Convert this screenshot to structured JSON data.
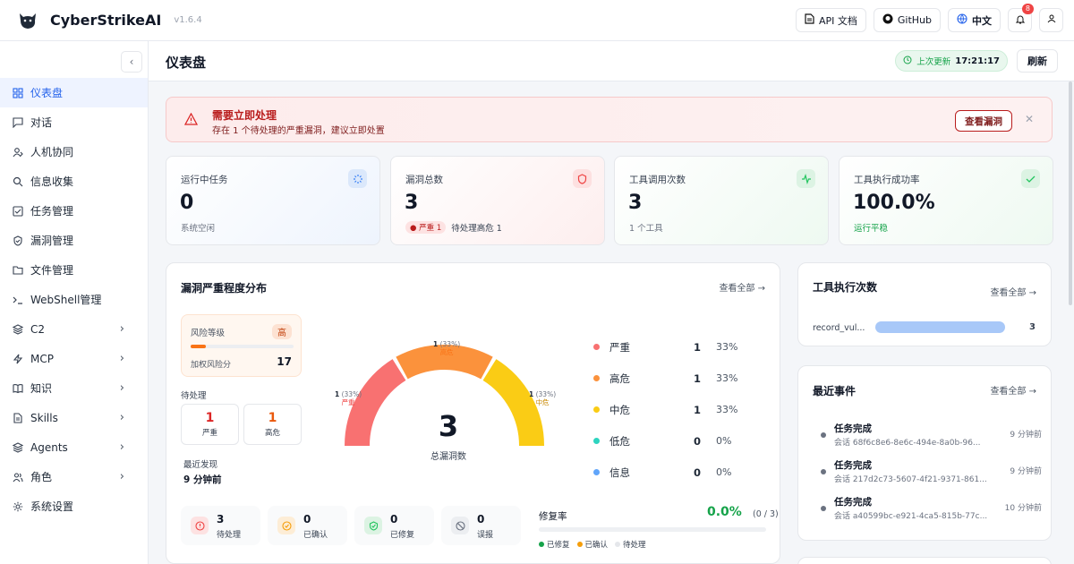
{
  "app": {
    "name": "CyberStrikeAI",
    "version": "v1.6.4"
  },
  "topbar": {
    "api_docs": "API 文档",
    "github": "GitHub",
    "language": "中文",
    "notification_count": "8"
  },
  "sidebar": {
    "items": [
      {
        "label": "仪表盘",
        "icon": "dashboard-icon"
      },
      {
        "label": "对话",
        "icon": "chat-icon"
      },
      {
        "label": "人机协同",
        "icon": "user-collab-icon"
      },
      {
        "label": "信息收集",
        "icon": "search-icon"
      },
      {
        "label": "任务管理",
        "icon": "task-icon"
      },
      {
        "label": "漏洞管理",
        "icon": "shield-icon"
      },
      {
        "label": "文件管理",
        "icon": "folder-icon"
      },
      {
        "label": "WebShell管理",
        "icon": "terminal-icon"
      },
      {
        "label": "C2",
        "icon": "layers-icon"
      },
      {
        "label": "MCP",
        "icon": "bolt-icon"
      },
      {
        "label": "知识",
        "icon": "book-icon"
      },
      {
        "label": "Skills",
        "icon": "document-icon"
      },
      {
        "label": "Agents",
        "icon": "layers-icon"
      },
      {
        "label": "角色",
        "icon": "users-icon"
      },
      {
        "label": "系统设置",
        "icon": "gear-icon"
      }
    ]
  },
  "header": {
    "title": "仪表盘",
    "last_update_label": "上次更新",
    "last_update_time": "17:21:17",
    "refresh": "刷新"
  },
  "alert": {
    "title": "需要立即处理",
    "desc": "存在 1 个待处理的严重漏洞，建议立即处置",
    "button": "查看漏洞"
  },
  "stats": [
    {
      "label": "运行中任务",
      "value": "0",
      "sub": "系统空闲"
    },
    {
      "label": "漏洞总数",
      "value": "3",
      "pill": "● 严重 1",
      "sub": "待处理高危 1"
    },
    {
      "label": "工具调用次数",
      "value": "3",
      "sub": "1 个工具"
    },
    {
      "label": "工具执行成功率",
      "value": "100.0%",
      "sub": "运行平稳"
    }
  ],
  "vuln_card": {
    "title": "漏洞严重程度分布",
    "view_all": "查看全部 →",
    "risk_label": "风险等级",
    "risk_level": "高",
    "risk_progress": 0.15,
    "risk_score_label": "加权风险分",
    "risk_score": "17",
    "pending_label": "待处理",
    "pending": [
      {
        "num": "1",
        "label": "严重"
      },
      {
        "num": "1",
        "label": "高危"
      }
    ],
    "recent_label": "最近发现",
    "recent_value": "9 分钟前",
    "total": "3",
    "total_label": "总漏洞数",
    "gauge_labels": [
      {
        "count": "1",
        "pct": "(33%)",
        "name": "严重"
      },
      {
        "count": "1",
        "pct": "(33%)",
        "name": "高危"
      },
      {
        "count": "1",
        "pct": "(33%)",
        "name": "中危"
      }
    ],
    "severity": [
      {
        "name": "严重",
        "count": "1",
        "pct": "33%",
        "color": "#f87171"
      },
      {
        "name": "高危",
        "count": "1",
        "pct": "33%",
        "color": "#fb923c"
      },
      {
        "name": "中危",
        "count": "1",
        "pct": "33%",
        "color": "#facc15"
      },
      {
        "name": "低危",
        "count": "0",
        "pct": "0%",
        "color": "#2dd4bf"
      },
      {
        "name": "信息",
        "count": "0",
        "pct": "0%",
        "color": "#60a5fa"
      }
    ],
    "status": [
      {
        "num": "3",
        "label": "待处理"
      },
      {
        "num": "0",
        "label": "已确认"
      },
      {
        "num": "0",
        "label": "已修复"
      },
      {
        "num": "0",
        "label": "误报"
      }
    ],
    "fix_label": "修复率",
    "fix_rate": "0.0%",
    "fix_frac": "(0 / 3)",
    "fix_legend": [
      "已修复",
      "已确认",
      "待处理"
    ]
  },
  "tools_card": {
    "title": "工具执行次数",
    "view_all": "查看全部 →",
    "tool_name": "record_vul...",
    "tool_count": "3"
  },
  "events_card": {
    "title": "最近事件",
    "view_all": "查看全部 →",
    "events": [
      {
        "title": "任务完成",
        "sub": "会话 68f6c8e6-8e6c-494e-8a0b-96...",
        "time": "9 分钟前"
      },
      {
        "title": "任务完成",
        "sub": "会话 217d2c73-5607-4f21-9371-861...",
        "time": "9 分钟前"
      },
      {
        "title": "任务完成",
        "sub": "会话 a40599bc-e921-4ca5-815b-77c...",
        "time": "10 分钟前"
      }
    ]
  }
}
